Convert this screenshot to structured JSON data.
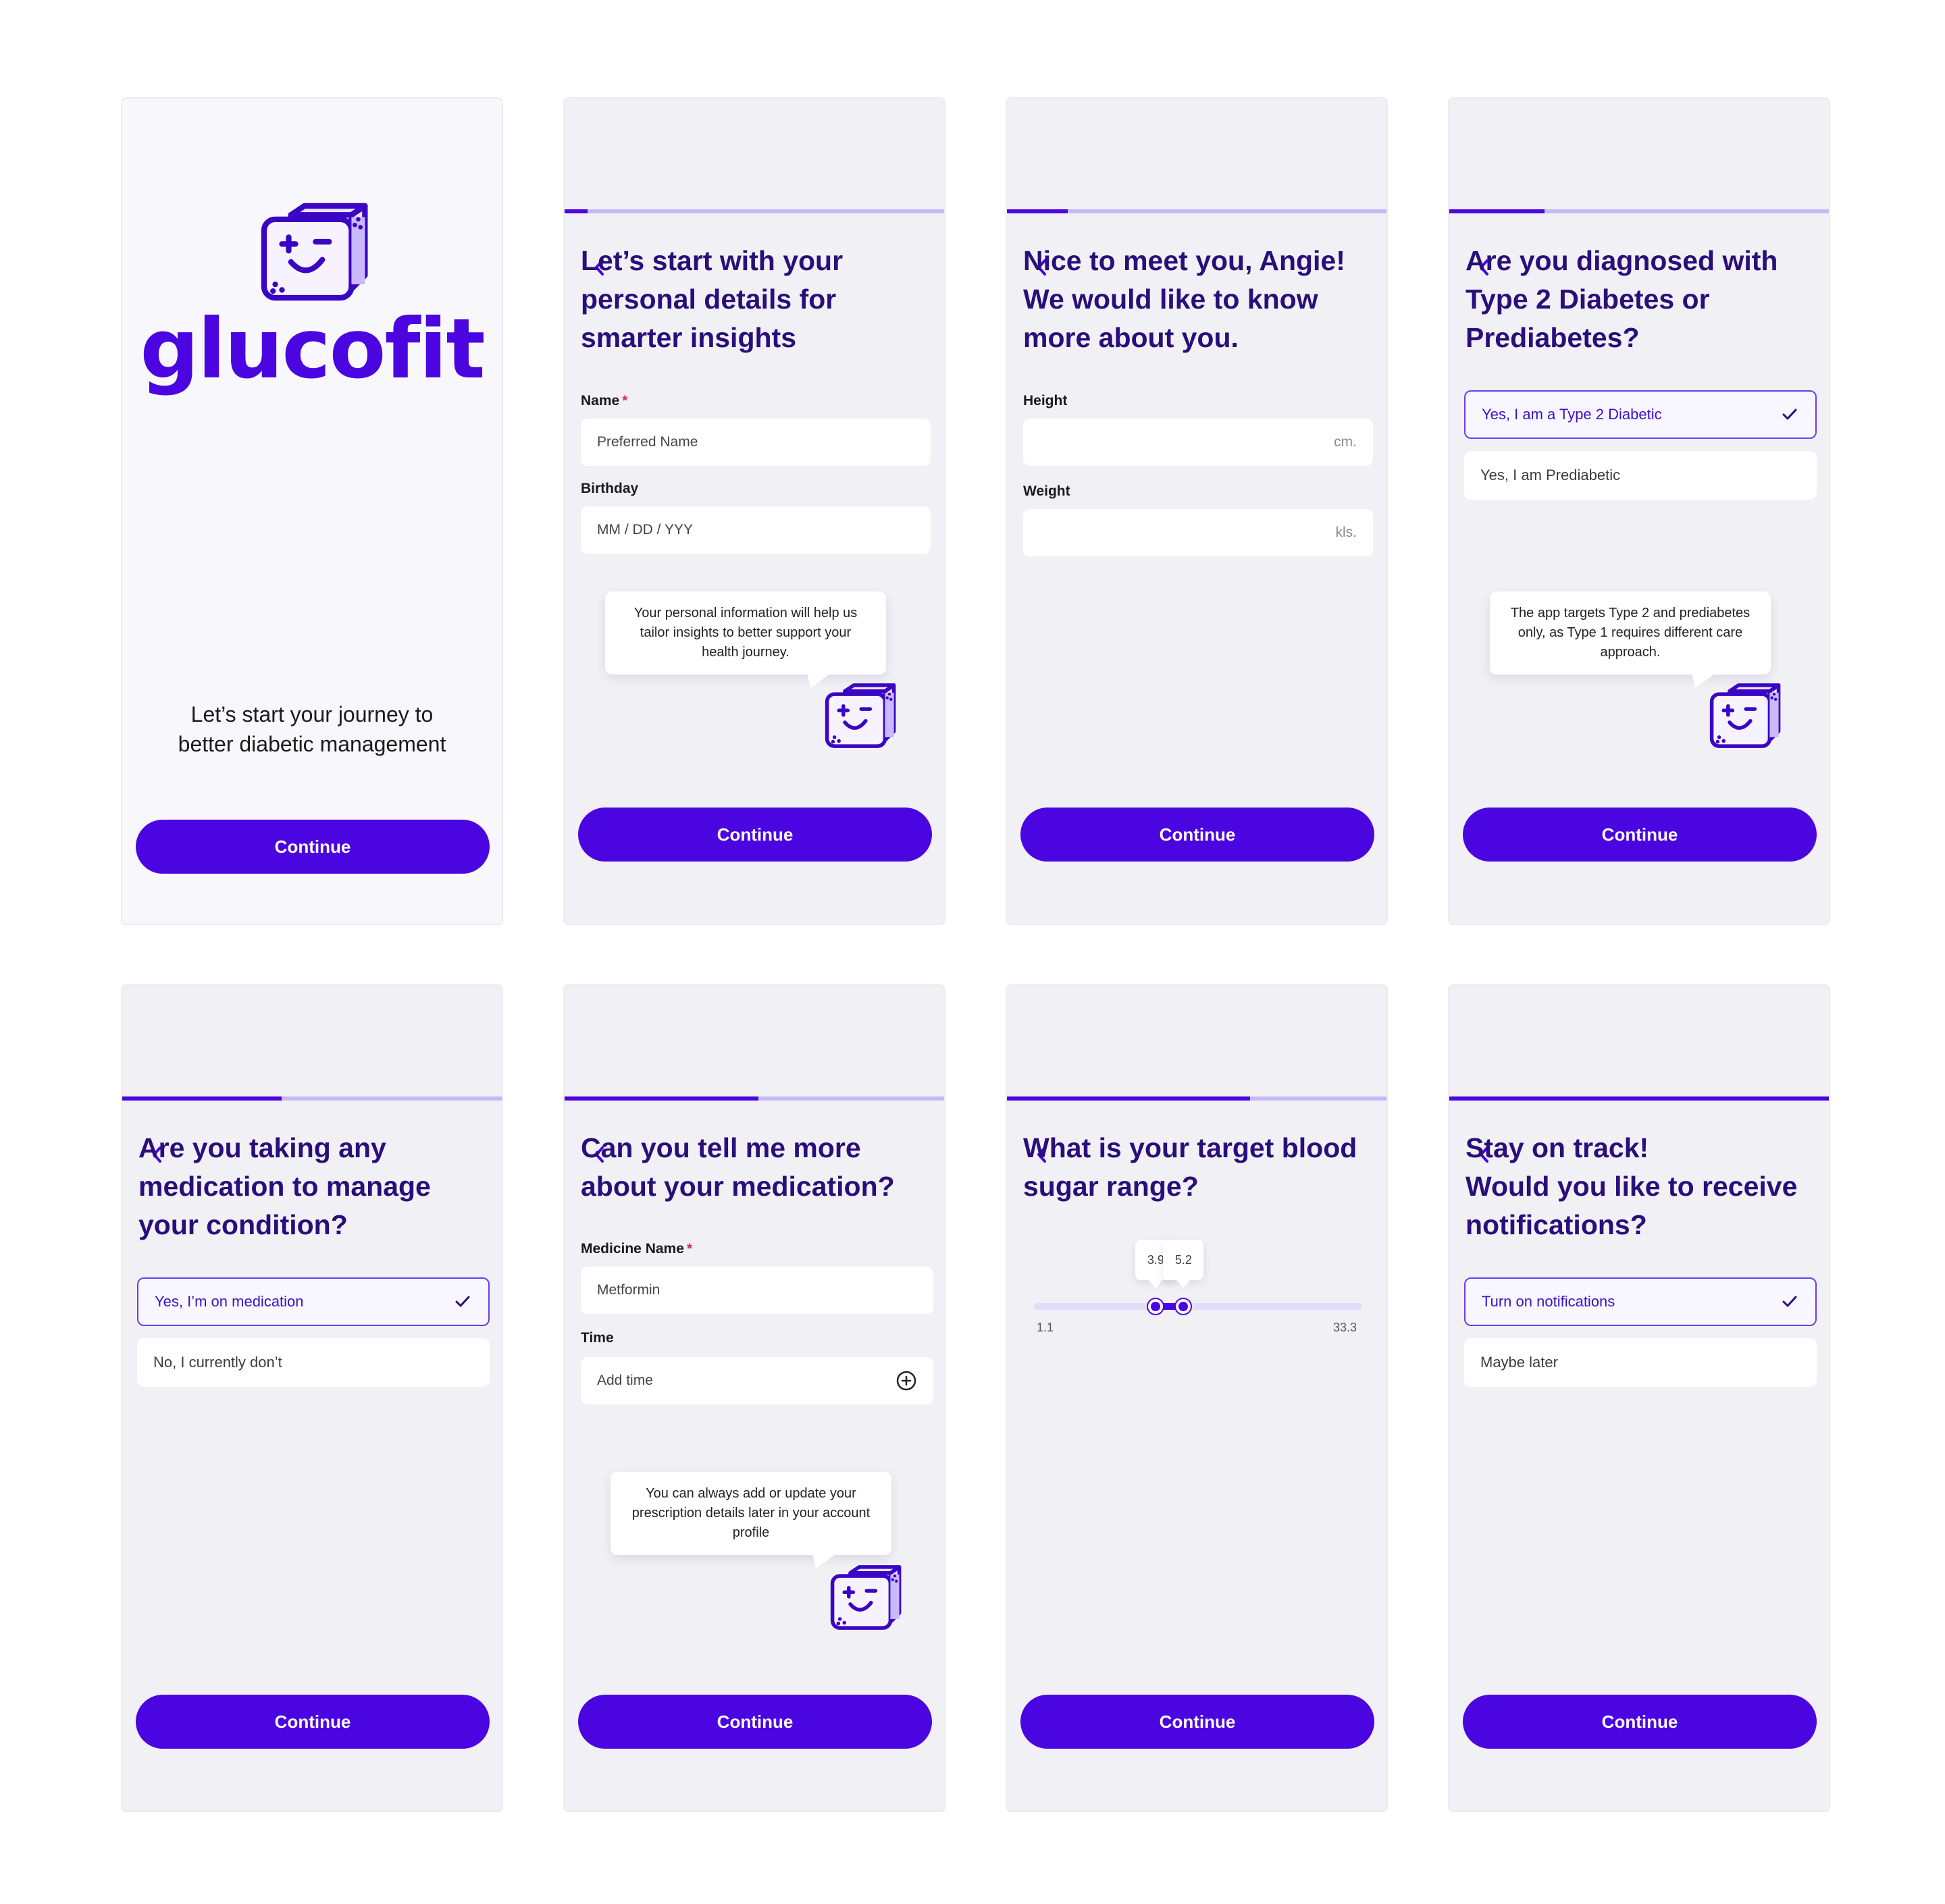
{
  "brand": {
    "name": "glucofit",
    "primary_color": "#4b05e0",
    "title_color": "#2a0f7a"
  },
  "common": {
    "continue_label": "Continue",
    "back_icon": "chevron-left-icon"
  },
  "screen1": {
    "tagline_line1": "Let’s start your journey to",
    "tagline_line2": "better diabetic management"
  },
  "screen2": {
    "progress": 0.06,
    "title_lines": [
      "Let’s start with your",
      "personal details for",
      "smarter insights"
    ],
    "name_label": "Name",
    "required_mark": "*",
    "name_placeholder": "Preferred Name",
    "birthday_label": "Birthday",
    "birthday_placeholder": "MM / DD / YYY",
    "tip": "Your personal information will help us tailor insights to better support your health journey."
  },
  "screen3": {
    "progress": 0.16,
    "title_lines": [
      "Nice to meet you, Angie!",
      "We would like to know",
      "more about you."
    ],
    "height_label": "Height",
    "height_unit": "cm.",
    "weight_label": "Weight",
    "weight_unit": "kls."
  },
  "screen4": {
    "progress": 0.25,
    "title_lines": [
      "Are you diagnosed with",
      "Type 2 Diabetes or",
      "Prediabetes?"
    ],
    "options": [
      {
        "label": "Yes, I am a Type 2 Diabetic",
        "selected": true
      },
      {
        "label": "Yes, I am Prediabetic",
        "selected": false
      }
    ],
    "tip": "The app targets Type 2 and prediabetes only, as Type 1 requires different care approach."
  },
  "screen5": {
    "progress": 0.42,
    "title_lines": [
      "Are you taking any",
      "medication to manage",
      "your condition?"
    ],
    "options": [
      {
        "label": "Yes, I’m on medication",
        "selected": true
      },
      {
        "label": "No, I currently don’t",
        "selected": false
      }
    ]
  },
  "screen6": {
    "progress": 0.51,
    "title_lines": [
      "Can you tell me more",
      "about your medication?"
    ],
    "medicine_label": "Medicine Name",
    "required_mark": "*",
    "medicine_value": "Metformin",
    "time_label": "Time",
    "time_placeholder": "Add time",
    "tip": "You can always add or update your prescription details later in your account profile"
  },
  "screen7": {
    "progress": 0.64,
    "title_lines": [
      "What is your target blood",
      "sugar range?"
    ],
    "slider": {
      "min": 1.1,
      "max": 33.3,
      "low": 3.9,
      "high": 5.2,
      "min_label": "1.1",
      "max_label": "33.3",
      "low_label": "3.9",
      "high_label": "5.2"
    }
  },
  "screen8": {
    "progress": 1.0,
    "title_lines": [
      "Stay on track!",
      "Would you like to receive",
      "notifications?"
    ],
    "options": [
      {
        "label": "Turn on notifications",
        "selected": true
      },
      {
        "label": "Maybe later",
        "selected": false
      }
    ]
  }
}
